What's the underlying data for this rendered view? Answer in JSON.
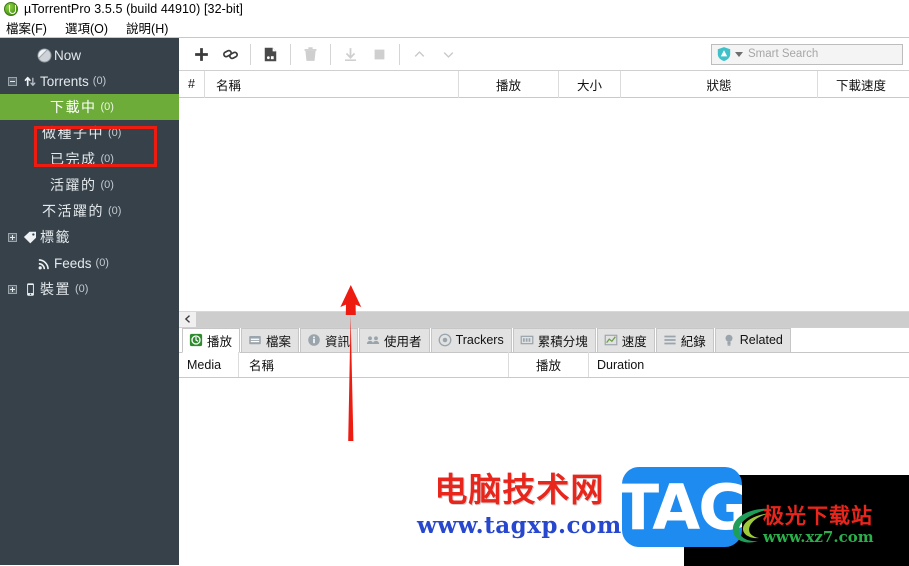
{
  "window": {
    "title": "µTorrentPro 3.5.5  (build 44910) [32-bit]",
    "logo_icon": "utorrent-logo-icon"
  },
  "menubar": {
    "items": [
      {
        "label": "檔案(F)",
        "name": "menu-file"
      },
      {
        "label": "選項(O)",
        "name": "menu-options"
      },
      {
        "label": "說明(H)",
        "name": "menu-help"
      }
    ]
  },
  "sidebar": {
    "items": [
      {
        "label": "Now",
        "count": "",
        "icon": "now-globe-icon",
        "level": 1,
        "expander": "none",
        "selected": false
      },
      {
        "label": "Torrents",
        "count": "(0)",
        "icon": "transfer-arrows-icon",
        "level": 0,
        "expander": "minus",
        "selected": false
      },
      {
        "label": "下載中",
        "count": "(0)",
        "icon": "none",
        "level": 2,
        "expander": "none",
        "selected": true
      },
      {
        "label": "做種子中",
        "count": "(0)",
        "icon": "none",
        "level": 2,
        "expander": "none",
        "selected": false
      },
      {
        "label": "已完成",
        "count": "(0)",
        "icon": "none",
        "level": 2,
        "expander": "none",
        "selected": false
      },
      {
        "label": "活躍的",
        "count": "(0)",
        "icon": "none",
        "level": 2,
        "expander": "none",
        "selected": false
      },
      {
        "label": "不活躍的",
        "count": "(0)",
        "icon": "none",
        "level": 2,
        "expander": "none",
        "selected": false
      },
      {
        "label": "標籤",
        "count": "",
        "icon": "tag-icon",
        "level": 0,
        "expander": "plus",
        "selected": false
      },
      {
        "label": "Feeds",
        "count": "(0)",
        "icon": "rss-icon",
        "level": 1,
        "expander": "none",
        "selected": false
      },
      {
        "label": "裝置",
        "count": "(0)",
        "icon": "phone-icon",
        "level": 0,
        "expander": "plus",
        "selected": false
      }
    ],
    "selection_color": "#6dac39",
    "background_color": "#36414a"
  },
  "toolbar": {
    "buttons": [
      {
        "name": "add-torrent-button",
        "icon": "plus-icon",
        "enabled": true
      },
      {
        "name": "add-torrent-from-url-button",
        "icon": "link-icon",
        "enabled": true
      },
      {
        "name": "create-torrent-button",
        "icon": "new-file-icon",
        "enabled": true
      },
      {
        "name": "remove-torrent-button",
        "icon": "trash-icon",
        "enabled": false
      },
      {
        "name": "start-torrent-button",
        "icon": "download-icon",
        "enabled": false
      },
      {
        "name": "stop-torrent-button",
        "icon": "stop-square-icon",
        "enabled": false
      },
      {
        "name": "move-up-button",
        "icon": "chevron-up-icon",
        "enabled": false
      },
      {
        "name": "move-down-button",
        "icon": "chevron-down-icon",
        "enabled": false
      }
    ]
  },
  "search": {
    "placeholder": "Smart Search",
    "value": "",
    "shield_icon": "shield-icon",
    "dropdown_icon": "chevron-down-icon",
    "shield_color": "#3fc1c9"
  },
  "torrent_list": {
    "columns": [
      {
        "label": "#",
        "name": "column-index"
      },
      {
        "label": "名稱",
        "name": "column-name"
      },
      {
        "label": "播放",
        "name": "column-play"
      },
      {
        "label": "大小",
        "name": "column-size"
      },
      {
        "label": "狀態",
        "name": "column-status"
      },
      {
        "label": "下載速度",
        "name": "column-download-speed"
      }
    ],
    "rows": []
  },
  "scrollbar": {
    "left_arrow_icon": "chevron-left-icon"
  },
  "detail_tabs": {
    "items": [
      {
        "label": "播放",
        "icon": "play-clock-icon",
        "active": true
      },
      {
        "label": "檔案",
        "icon": "files-icon",
        "active": false
      },
      {
        "label": "資訊",
        "icon": "info-icon",
        "active": false
      },
      {
        "label": "使用者",
        "icon": "peers-icon",
        "active": false
      },
      {
        "label": "Trackers",
        "icon": "target-icon",
        "active": false
      },
      {
        "label": "累積分塊",
        "icon": "pieces-icon",
        "active": false
      },
      {
        "label": "速度",
        "icon": "speed-graph-icon",
        "active": false
      },
      {
        "label": "紀錄",
        "icon": "log-lines-icon",
        "active": false
      },
      {
        "label": "Related",
        "icon": "bulb-icon",
        "active": false
      }
    ]
  },
  "detail_panel": {
    "columns": [
      {
        "label": "Media",
        "name": "detail-column-media"
      },
      {
        "label": "名稱",
        "name": "detail-column-name"
      },
      {
        "label": "播放",
        "name": "detail-column-play"
      },
      {
        "label": "Duration",
        "name": "detail-column-duration"
      }
    ],
    "rows": []
  },
  "annotations": {
    "highlight_box_color": "#ee1b11",
    "arrow_color": "#ee1b11"
  },
  "watermarks": {
    "tagxp": {
      "line1": "电脑技术网",
      "line2": "www.tagxp.com"
    },
    "tag_logo": {
      "text": "TAG"
    },
    "xz7": {
      "line1": "极光下载站",
      "line2": "www.xz7.com"
    }
  }
}
